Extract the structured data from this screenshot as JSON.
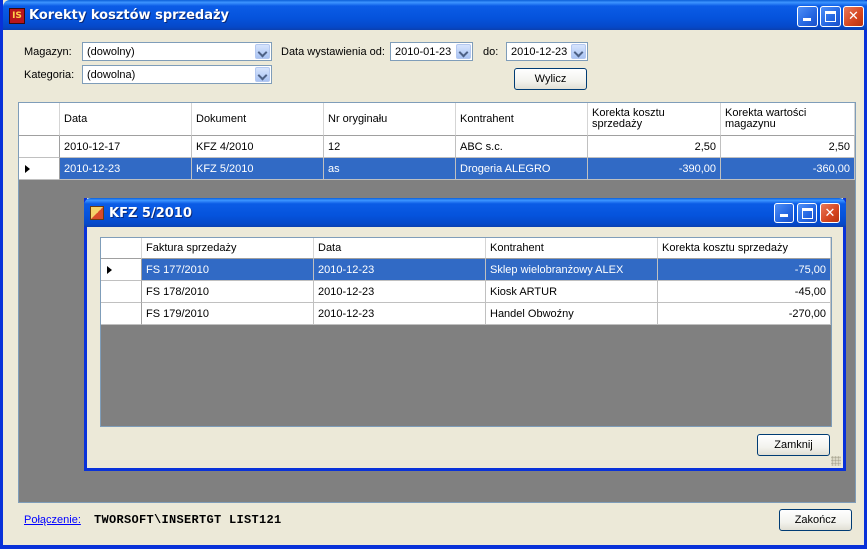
{
  "window": {
    "title": "Korekty kosztów sprzedaży",
    "app_icon_text": "IS"
  },
  "filters": {
    "magazyn_label": "Magazyn:",
    "magazyn_value": "(dowolny)",
    "kategoria_label": "Kategoria:",
    "kategoria_value": "(dowolna)",
    "date_from_label": "Data wystawienia od:",
    "date_from_value": "2010-01-23",
    "date_to_label": "do:",
    "date_to_value": "2010-12-23",
    "calc_button": "Wylicz"
  },
  "main_grid": {
    "columns": [
      "Data",
      "Dokument",
      "Nr oryginału",
      "Kontrahent",
      "Korekta kosztu sprzedaży",
      "Korekta wartości magazynu"
    ],
    "rows": [
      {
        "data": "2010-12-17",
        "dokument": "KFZ 4/2010",
        "nr": "12",
        "kontrahent": "ABC s.c.",
        "korekta_kosztu": "2,50",
        "korekta_wartosci": "2,50"
      },
      {
        "data": "2010-12-23",
        "dokument": "KFZ 5/2010",
        "nr": "as",
        "kontrahent": "Drogeria ALEGRO",
        "korekta_kosztu": "-390,00",
        "korekta_wartosci": "-360,00"
      }
    ],
    "selected_row": 1
  },
  "detail_window": {
    "title": "KFZ 5/2010",
    "columns": [
      "Faktura sprzedaży",
      "Data",
      "Kontrahent",
      "Korekta kosztu sprzedaży"
    ],
    "rows": [
      {
        "faktura": "FS 177/2010",
        "data": "2010-12-23",
        "kontrahent": "Sklep wielobranżowy  ALEX",
        "korekta": "-75,00"
      },
      {
        "faktura": "FS 178/2010",
        "data": "2010-12-23",
        "kontrahent": "Kiosk ARTUR",
        "korekta": "-45,00"
      },
      {
        "faktura": "FS 179/2010",
        "data": "2010-12-23",
        "kontrahent": "Handel Obwoźny",
        "korekta": "-270,00"
      }
    ],
    "selected_row": 0,
    "close_button": "Zamknij"
  },
  "footer": {
    "connection_link": "Połączenie:",
    "connection_value": "TWORSOFT\\INSERTGT  LIST121",
    "exit_button": "Zakończ"
  },
  "colors": {
    "title_bar": "#0553dc",
    "selection": "#316ac5",
    "grid_background": "#808080",
    "window_face": "#ece9d8"
  }
}
